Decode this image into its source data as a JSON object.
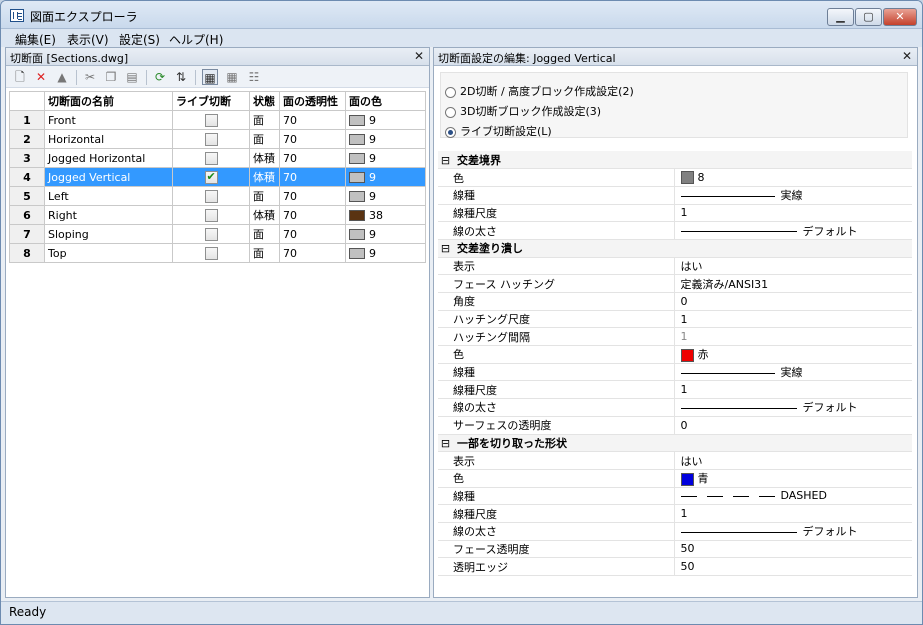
{
  "window": {
    "title": "図面エクスプローラ",
    "min": "▁",
    "max": "▢",
    "close": "✕"
  },
  "menu": [
    "編集(E)",
    "表示(V)",
    "設定(S)",
    "ヘルプ(H)"
  ],
  "left_pane": {
    "title": "切断面 [Sections.dwg]",
    "close": "✕",
    "toolbar_icons": [
      "new-section-icon",
      "delete-icon",
      "...",
      "cut-icon",
      "copy-icon",
      "paste-icon",
      "refresh-icon",
      "sync-icon",
      "list-view-icon",
      "grid-view-icon",
      "detail-view-icon"
    ],
    "columns": [
      "切断面の名前",
      "ライブ切断",
      "状態",
      "面の透明性",
      "面の色"
    ],
    "rows": [
      {
        "n": "1",
        "name": "Front",
        "live": false,
        "state": "面",
        "trans": "70",
        "color": "9",
        "swatch": "#c0c0c0"
      },
      {
        "n": "2",
        "name": "Horizontal",
        "live": false,
        "state": "面",
        "trans": "70",
        "color": "9",
        "swatch": "#c0c0c0"
      },
      {
        "n": "3",
        "name": "Jogged Horizontal",
        "live": false,
        "state": "体積",
        "trans": "70",
        "color": "9",
        "swatch": "#c0c0c0"
      },
      {
        "n": "4",
        "name": "Jogged Vertical",
        "live": true,
        "state": "体積",
        "trans": "70",
        "color": "9",
        "swatch": "#c0c0c0",
        "selected": true
      },
      {
        "n": "5",
        "name": "Left",
        "live": false,
        "state": "面",
        "trans": "70",
        "color": "9",
        "swatch": "#c0c0c0"
      },
      {
        "n": "6",
        "name": "Right",
        "live": false,
        "state": "体積",
        "trans": "70",
        "color": "38",
        "swatch": "#5a3312"
      },
      {
        "n": "7",
        "name": "Sloping",
        "live": false,
        "state": "面",
        "trans": "70",
        "color": "9",
        "swatch": "#c0c0c0"
      },
      {
        "n": "8",
        "name": "Top",
        "live": false,
        "state": "面",
        "trans": "70",
        "color": "9",
        "swatch": "#c0c0c0"
      }
    ]
  },
  "right_pane": {
    "title": "切断面設定の編集: Jogged Vertical",
    "close": "✕",
    "radios": [
      {
        "label": "2D切断 / 高度ブロック作成設定(2)",
        "on": false
      },
      {
        "label": "3D切断ブロック作成設定(3)",
        "on": false
      },
      {
        "label": "ライブ切断設定(L)",
        "on": true
      }
    ],
    "sections": [
      {
        "title": "交差境界",
        "toggle": "⊟",
        "rows": [
          {
            "k": "色",
            "v": "8",
            "swatch": "#808080"
          },
          {
            "k": "線種",
            "v": "実線",
            "line": "solid"
          },
          {
            "k": "線種尺度",
            "v": "1"
          },
          {
            "k": "線の太さ",
            "v": "デフォルト",
            "line": "long"
          }
        ]
      },
      {
        "title": "交差塗り潰し",
        "toggle": "⊟",
        "rows": [
          {
            "k": "表示",
            "v": "はい"
          },
          {
            "k": "フェース ハッチング",
            "v": "定義済み/ANSI31"
          },
          {
            "k": "角度",
            "v": "0"
          },
          {
            "k": "ハッチング尺度",
            "v": "1"
          },
          {
            "k": "ハッチング間隔",
            "v": "1",
            "dim": true
          },
          {
            "k": "色",
            "v": "赤",
            "swatch": "#ee0000"
          },
          {
            "k": "線種",
            "v": "実線",
            "line": "solid"
          },
          {
            "k": "線種尺度",
            "v": "1"
          },
          {
            "k": "線の太さ",
            "v": "デフォルト",
            "line": "long"
          },
          {
            "k": "サーフェスの透明度",
            "v": "0"
          }
        ]
      },
      {
        "title": "一部を切り取った形状",
        "toggle": "⊟",
        "rows": [
          {
            "k": "表示",
            "v": "はい"
          },
          {
            "k": "色",
            "v": "青",
            "swatch": "#0000dd"
          },
          {
            "k": "線種",
            "v": "DASHED",
            "line": "dashed"
          },
          {
            "k": "線種尺度",
            "v": "1"
          },
          {
            "k": "線の太さ",
            "v": "デフォルト",
            "line": "long"
          },
          {
            "k": "フェース透明度",
            "v": "50"
          },
          {
            "k": "透明エッジ",
            "v": "50"
          }
        ]
      }
    ]
  },
  "status": "Ready"
}
